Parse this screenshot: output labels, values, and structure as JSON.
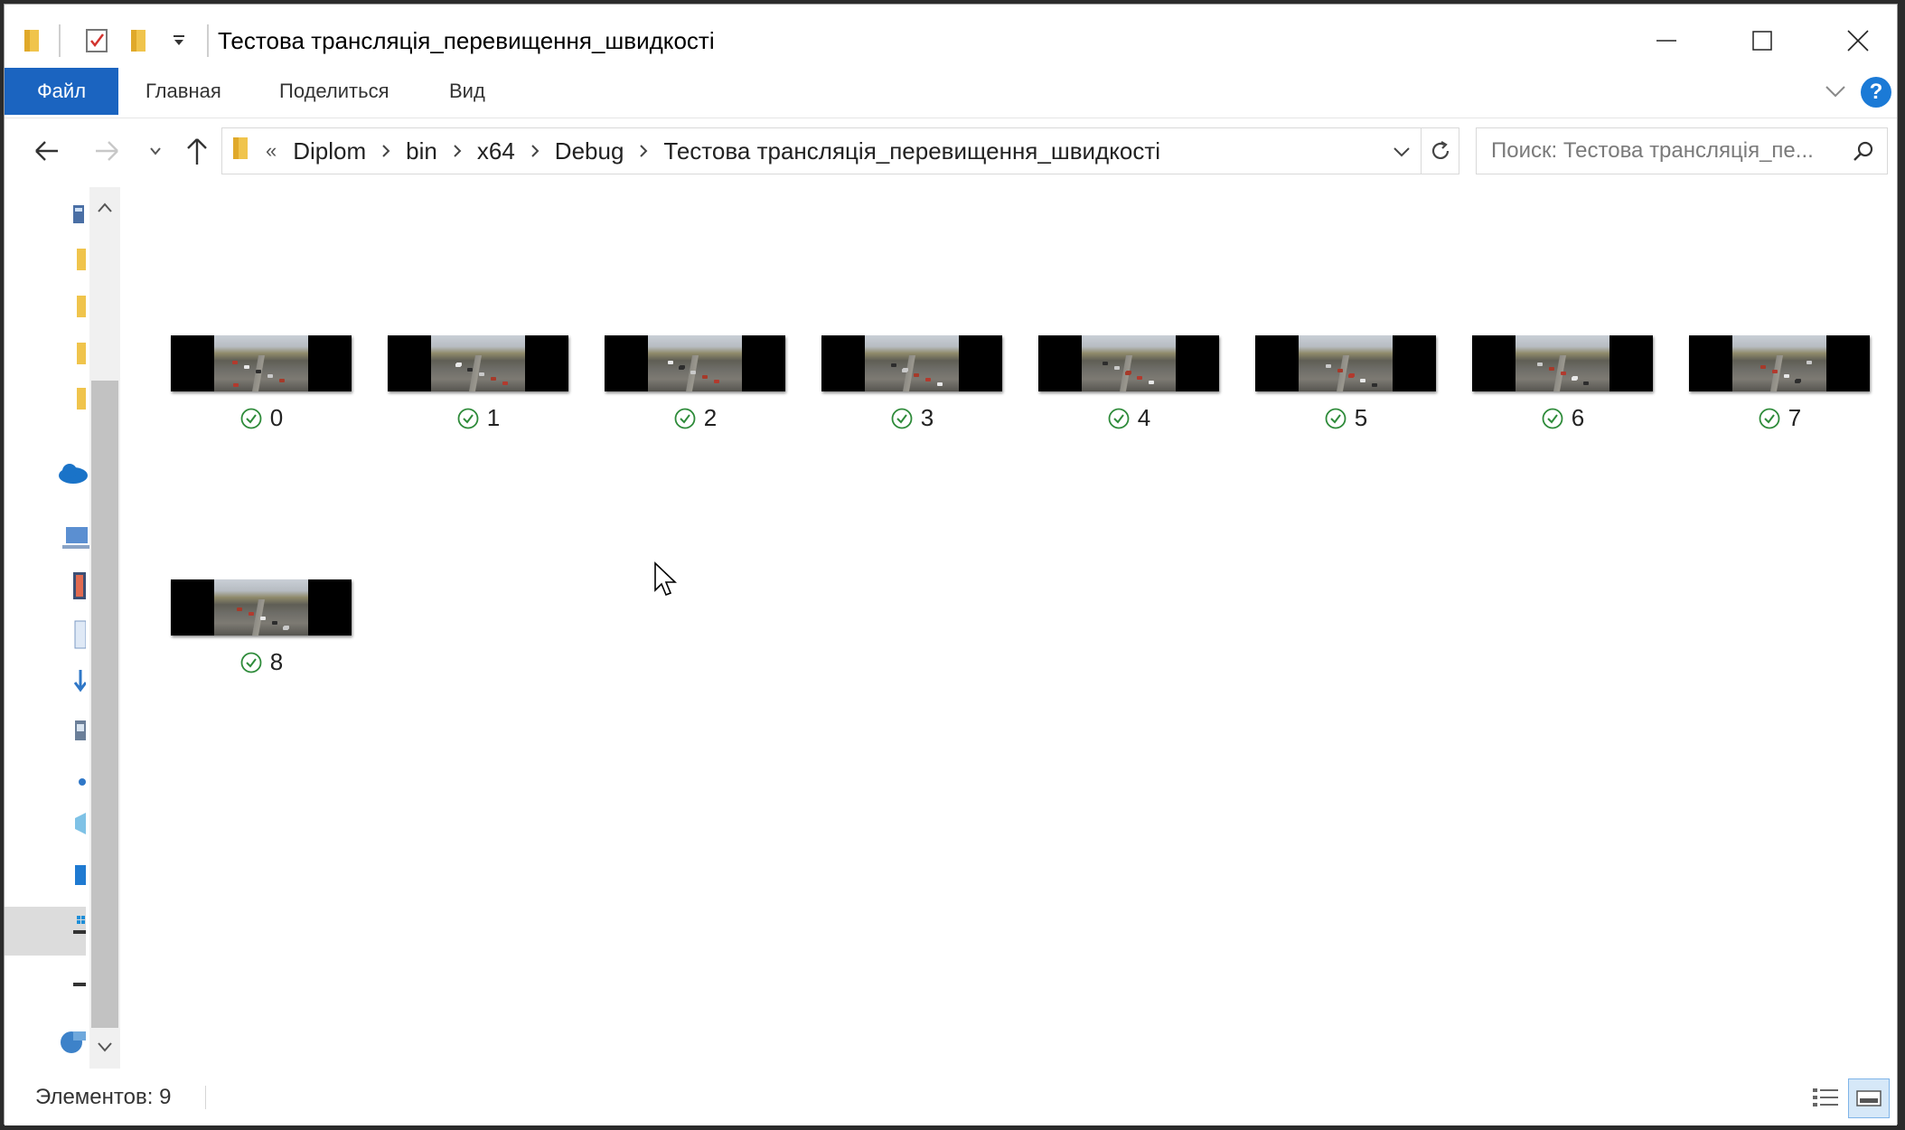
{
  "window": {
    "title": "Тестова трансляція_перевищення_швидкості"
  },
  "ribbon": {
    "tabs": [
      {
        "label": "Файл"
      },
      {
        "label": "Главная"
      },
      {
        "label": "Поделиться"
      },
      {
        "label": "Вид"
      }
    ],
    "help_label": "?"
  },
  "address": {
    "overflow": "«",
    "crumbs": [
      "Diplom",
      "bin",
      "x64",
      "Debug",
      "Тестова трансляція_перевищення_швидкості"
    ]
  },
  "search": {
    "placeholder": "Поиск: Тестова трансляція_пе..."
  },
  "files": [
    {
      "name": "0"
    },
    {
      "name": "1"
    },
    {
      "name": "2"
    },
    {
      "name": "3"
    },
    {
      "name": "4"
    },
    {
      "name": "5"
    },
    {
      "name": "6"
    },
    {
      "name": "7"
    },
    {
      "name": "8"
    }
  ],
  "status": {
    "count_text": "Элементов: 9"
  },
  "colors": {
    "file_tab": "#1b64c0",
    "sync_ok": "#2e8b3a",
    "folder": "#f0c44c"
  }
}
